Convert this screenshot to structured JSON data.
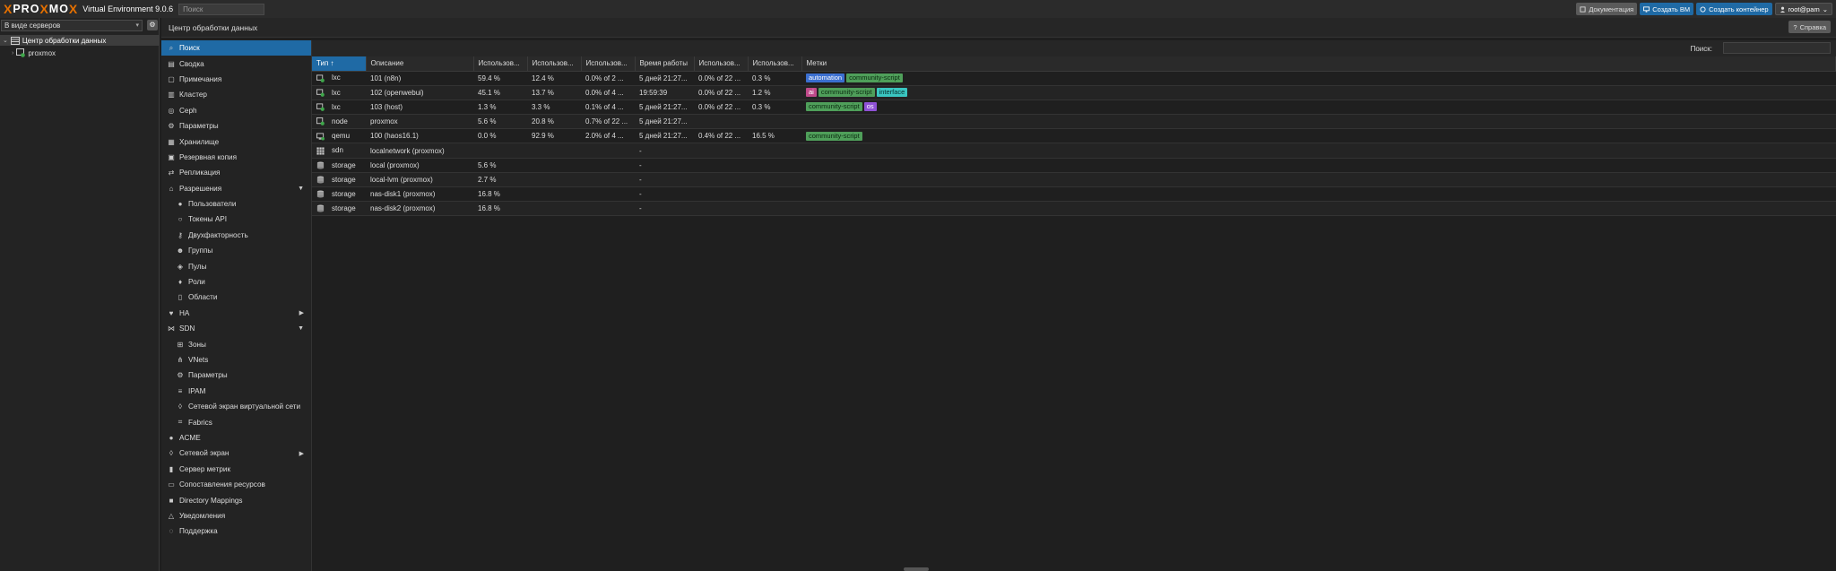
{
  "app": {
    "logo_prefix": "PRO",
    "logo_x": "X",
    "logo_mid": "MO",
    "version": "Virtual Environment 9.0.6",
    "search_placeholder": "Поиск"
  },
  "topbar": {
    "docs": "Документация",
    "create_vm": "Создать ВМ",
    "create_ct": "Создать контейнер",
    "user": "root@pam"
  },
  "tree": {
    "view_selector": "В виде серверов",
    "datacenter": "Центр обработки данных",
    "node": "proxmox"
  },
  "header": {
    "title": "Центр обработки данных",
    "help": "Справка"
  },
  "menu": [
    {
      "label": "Поиск",
      "icon": "search-icon",
      "selected": true
    },
    {
      "label": "Сводка",
      "icon": "book-icon"
    },
    {
      "label": "Примечания",
      "icon": "notes-icon"
    },
    {
      "label": "Кластер",
      "icon": "server-icon"
    },
    {
      "label": "Ceph",
      "icon": "ceph-icon"
    },
    {
      "label": "Параметры",
      "icon": "gear-icon"
    },
    {
      "label": "Хранилище",
      "icon": "database-icon"
    },
    {
      "label": "Резервная копия",
      "icon": "floppy-icon"
    },
    {
      "label": "Репликация",
      "icon": "retweet-icon"
    },
    {
      "label": "Разрешения",
      "icon": "unlock-icon",
      "arrow": "down"
    },
    {
      "label": "Пользователи",
      "icon": "user-icon",
      "sub": true
    },
    {
      "label": "Токены API",
      "icon": "user-outline-icon",
      "sub": true
    },
    {
      "label": "Двухфакторность",
      "icon": "key-icon",
      "sub": true
    },
    {
      "label": "Группы",
      "icon": "users-icon",
      "sub": true
    },
    {
      "label": "Пулы",
      "icon": "tags-icon",
      "sub": true
    },
    {
      "label": "Роли",
      "icon": "male-icon",
      "sub": true
    },
    {
      "label": "Области",
      "icon": "address-book-icon",
      "sub": true
    },
    {
      "label": "HA",
      "icon": "heartbeat-icon",
      "arrow": "right"
    },
    {
      "label": "SDN",
      "icon": "sdn-icon",
      "arrow": "down"
    },
    {
      "label": "Зоны",
      "icon": "th-icon",
      "sub": true
    },
    {
      "label": "VNets",
      "icon": "network-icon",
      "sub": true
    },
    {
      "label": "Параметры",
      "icon": "gear-icon",
      "sub": true
    },
    {
      "label": "IPAM",
      "icon": "ipam-icon",
      "sub": true
    },
    {
      "label": "Сетевой экран виртуальной сети",
      "icon": "shield-icon",
      "sub": true
    },
    {
      "label": "Fabrics",
      "icon": "fabric-icon",
      "sub": true
    },
    {
      "label": "ACME",
      "icon": "certificate-icon"
    },
    {
      "label": "Сетевой экран",
      "icon": "shield-icon",
      "arrow": "right"
    },
    {
      "label": "Сервер метрик",
      "icon": "bar-chart-icon"
    },
    {
      "label": "Сопоставления ресурсов",
      "icon": "folder-outline-icon"
    },
    {
      "label": "Directory Mappings",
      "icon": "folder-icon"
    },
    {
      "label": "Уведомления",
      "icon": "bell-icon"
    },
    {
      "label": "Поддержка",
      "icon": "comments-icon"
    }
  ],
  "grid": {
    "search_label": "Поиск:",
    "columns": [
      "Тип ↑",
      "Описание",
      "Использов...",
      "Использов...",
      "Использов...",
      "Время работы",
      "Использов...",
      "Использов...",
      "Метки"
    ],
    "rows": [
      {
        "type": "lxc",
        "icon": "container-icon",
        "desc": "101 (n8n)",
        "c1": "59.4 %",
        "c2": "12.4 %",
        "c3": "0.0% of 2 ...",
        "uptime": "5 дней 21:27...",
        "c5": "0.0% of 22 ...",
        "c6": "0.3 %",
        "tags": [
          "automation",
          "community-script"
        ]
      },
      {
        "type": "lxc",
        "icon": "container-icon",
        "desc": "102 (openwebui)",
        "c1": "45.1 %",
        "c2": "13.7 %",
        "c3": "0.0% of 4 ...",
        "uptime": "19:59:39",
        "c5": "0.0% of 22 ...",
        "c6": "1.2 %",
        "tags": [
          "ai",
          "community-script",
          "interface"
        ]
      },
      {
        "type": "lxc",
        "icon": "container-icon",
        "desc": "103 (host)",
        "c1": "1.3 %",
        "c2": "3.3 %",
        "c3": "0.1% of 4 ...",
        "uptime": "5 дней 21:27...",
        "c5": "0.0% of 22 ...",
        "c6": "0.3 %",
        "tags": [
          "community-script",
          "os"
        ]
      },
      {
        "type": "node",
        "icon": "node-icon",
        "desc": "proxmox",
        "c1": "5.6 %",
        "c2": "20.8 %",
        "c3": "0.7% of 22 ...",
        "uptime": "5 дней 21:27...",
        "c5": "",
        "c6": "",
        "tags": []
      },
      {
        "type": "qemu",
        "icon": "vm-icon",
        "desc": "100 (haos16.1)",
        "c1": "0.0 %",
        "c2": "92.9 %",
        "c3": "2.0% of 4 ...",
        "uptime": "5 дней 21:27...",
        "c5": "0.4% of 22 ...",
        "c6": "16.5 %",
        "tags": [
          "community-script"
        ]
      },
      {
        "type": "sdn",
        "icon": "sdn-grid-icon",
        "desc": "localnetwork (proxmox)",
        "c1": "",
        "c2": "",
        "c3": "",
        "uptime": "-",
        "c5": "",
        "c6": "",
        "tags": []
      },
      {
        "type": "storage",
        "icon": "storage-icon",
        "desc": "local (proxmox)",
        "c1": "5.6 %",
        "c2": "",
        "c3": "",
        "uptime": "-",
        "c5": "",
        "c6": "",
        "tags": []
      },
      {
        "type": "storage",
        "icon": "storage-icon",
        "desc": "local-lvm (proxmox)",
        "c1": "2.7 %",
        "c2": "",
        "c3": "",
        "uptime": "-",
        "c5": "",
        "c6": "",
        "tags": []
      },
      {
        "type": "storage",
        "icon": "storage-icon",
        "desc": "nas-disk1 (proxmox)",
        "c1": "16.8 %",
        "c2": "",
        "c3": "",
        "uptime": "-",
        "c5": "",
        "c6": "",
        "tags": []
      },
      {
        "type": "storage",
        "icon": "storage-icon",
        "desc": "nas-disk2 (proxmox)",
        "c1": "16.8 %",
        "c2": "",
        "c3": "",
        "uptime": "-",
        "c5": "",
        "c6": "",
        "tags": []
      }
    ]
  }
}
